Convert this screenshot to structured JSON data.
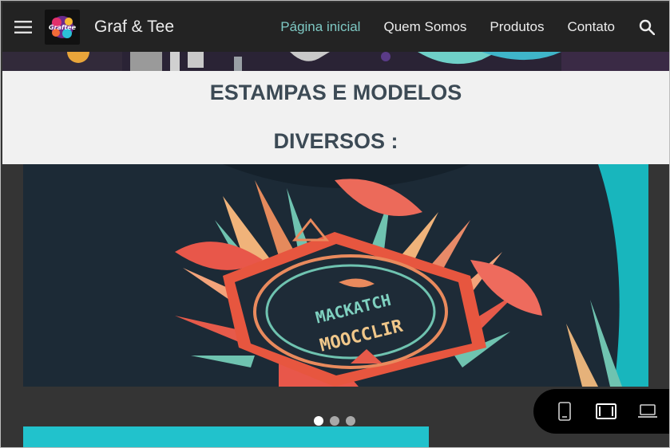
{
  "header": {
    "site_title": "Graf & Tee",
    "logo_text": "Graftee",
    "nav": [
      {
        "label": "Página inicial",
        "active": true
      },
      {
        "label": "Quem Somos",
        "active": false
      },
      {
        "label": "Produtos",
        "active": false
      },
      {
        "label": "Contato",
        "active": false
      }
    ]
  },
  "main": {
    "heading_line1": "ESTAMPAS E MODELOS",
    "heading_line2": "DIVERSOS :"
  },
  "carousel": {
    "shirt_text_1": "MACKATCH",
    "shirt_text_2": "MOOCCLIR",
    "slide_count": 3,
    "active_slide": 1
  },
  "colors": {
    "topbar": "#232323",
    "nav_active": "#7ec8c3",
    "accent_cyan": "#21c2cc",
    "heading": "#3c4a55"
  },
  "icons": [
    "menu-icon",
    "search-icon",
    "phone-preview-icon",
    "tablet-preview-icon",
    "laptop-preview-icon"
  ]
}
